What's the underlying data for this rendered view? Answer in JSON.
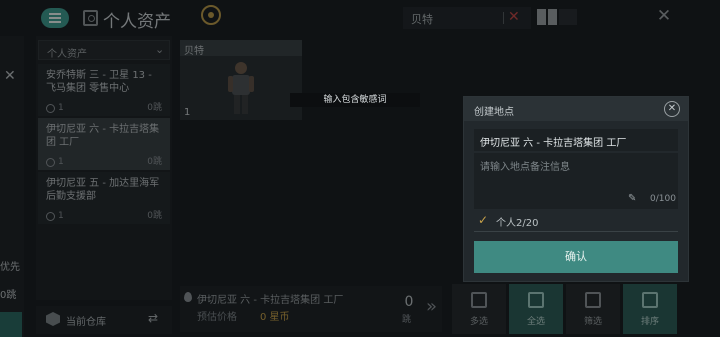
{
  "header": {
    "title": "个人资产",
    "search_value": "贝特",
    "search_clear": "✕",
    "close_glyph": "✕"
  },
  "left_edge": {
    "close_glyph": "✕",
    "text1": "优先",
    "text2": "0跳"
  },
  "locations": {
    "header": "个人资产",
    "items": [
      {
        "name": "安乔特斯 三 - 卫星 13 - 飞马集团 零售中心",
        "count": "1",
        "cap": "0跳"
      },
      {
        "name": "伊切尼亚 六 - 卡拉吉塔集团 工厂",
        "count": "1",
        "cap": "0跳"
      },
      {
        "name": "伊切尼亚 五 - 加达里海军 后勤支援部",
        "count": "1",
        "cap": "0跳"
      }
    ]
  },
  "warehouse": {
    "label": "当前仓库",
    "swap_glyph": "⇄"
  },
  "item_card": {
    "name": "贝特",
    "count": "1"
  },
  "tooltip": "输入包含敏感词",
  "info_bar": {
    "location": "伊切尼亚 六 - 卡拉吉塔集团 工厂",
    "price_label": "预估价格",
    "price_value": "0 星币",
    "qty": "0",
    "qty_unit": "跳",
    "arrow": "»"
  },
  "actions": [
    {
      "label": "多选",
      "accent": false
    },
    {
      "label": "全选",
      "accent": true
    },
    {
      "label": "筛选",
      "accent": false
    },
    {
      "label": "排序",
      "accent": true
    }
  ],
  "modal": {
    "title": "创建地点",
    "close_glyph": "✕",
    "name_value": "伊切尼亚 六 - 卡拉吉塔集团 工厂",
    "note_placeholder": "请输入地点备注信息",
    "note_count": "0/100",
    "checkbox_label": "个人2/20",
    "confirm_label": "确认"
  }
}
